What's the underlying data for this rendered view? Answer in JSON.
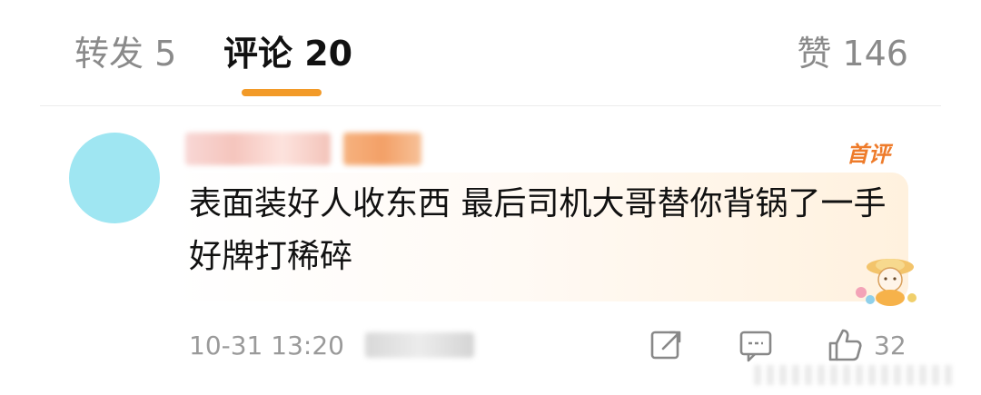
{
  "tabs": {
    "repost": "转发 5",
    "comment": "评论 20",
    "like": "赞 146"
  },
  "comment": {
    "badge": "首评",
    "text": "表面装好人收东西  最后司机大哥替你背锅了一手好牌打稀碎",
    "time": "10-31 13:20",
    "like_count": "32"
  },
  "colors": {
    "accent": "#f29a28",
    "badge": "#ee7b2a",
    "avatar": "#9fe6f2"
  },
  "icons": [
    "share-icon",
    "comment-icon",
    "thumbs-up-icon"
  ]
}
